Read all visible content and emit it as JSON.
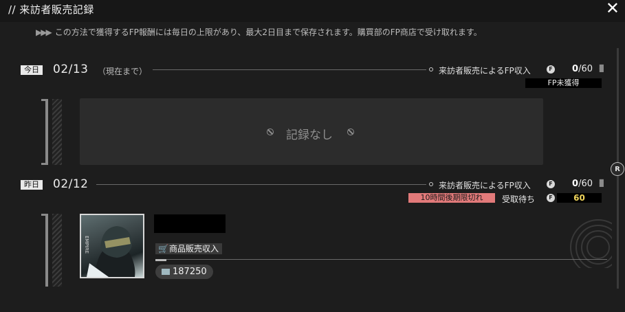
{
  "header": {
    "title": "// 来訪者販売記録",
    "notice": "この方法で獲得するFP報酬には毎日の上限があり、最大2日目まで保存されます。購買部のFP商店で受け取れます。"
  },
  "days": [
    {
      "tag": "今日",
      "date": "02/13",
      "sub": "（現在まで）",
      "fp_label": "来訪者販売によるFP収入",
      "count_current": "0",
      "count_total": "/60",
      "status": "FP未獲得",
      "empty_text": "記録なし"
    },
    {
      "tag": "昨日",
      "date": "02/12",
      "fp_label": "来訪者販売によるFP収入",
      "count_current": "0",
      "count_total": "/60",
      "expire_text": "10時間後期限切れ",
      "pending_label": "受取待ち",
      "pending_value": "60",
      "entry": {
        "shop_label": "商品販売収入",
        "amount": "187250"
      }
    }
  ],
  "scroll_handle": "R",
  "coin_glyph": "F",
  "colors": {
    "accent_red": "#e27a7a",
    "accent_yellow": "#f0d55c"
  }
}
